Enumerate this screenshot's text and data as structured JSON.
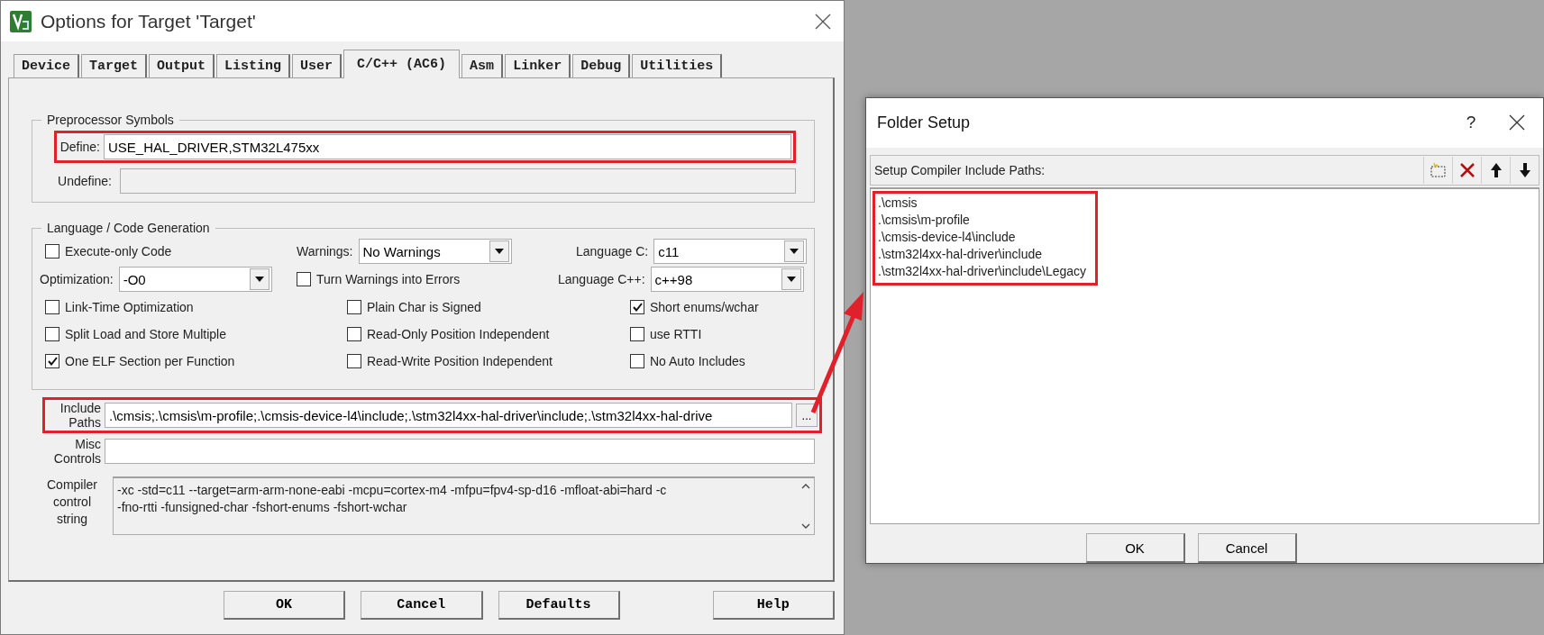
{
  "options_dialog": {
    "title": "Options for Target 'Target'",
    "tabs": [
      {
        "label": "Device",
        "selected": false
      },
      {
        "label": "Target",
        "selected": false
      },
      {
        "label": "Output",
        "selected": false
      },
      {
        "label": "Listing",
        "selected": false
      },
      {
        "label": "User",
        "selected": false
      },
      {
        "label": "C/C++ (AC6)",
        "selected": true
      },
      {
        "label": "Asm",
        "selected": false
      },
      {
        "label": "Linker",
        "selected": false
      },
      {
        "label": "Debug",
        "selected": false
      },
      {
        "label": "Utilities",
        "selected": false
      }
    ],
    "preprocessor": {
      "title": "Preprocessor Symbols",
      "define": {
        "label": "Define:",
        "value": "USE_HAL_DRIVER,STM32L475xx",
        "highlighted": true
      },
      "undefine": {
        "label": "Undefine:",
        "disabled": true
      }
    },
    "code_generation": {
      "title": "Language / Code Generation",
      "rows": [
        [
          {
            "kind": "checkbox",
            "label": "Execute-only Code",
            "checked": false
          },
          {
            "kind": "dropdown",
            "label": "Warnings:",
            "value": "No Warnings"
          },
          {
            "kind": "dropdown",
            "label": "Language C:",
            "value": "c11"
          }
        ],
        [
          {
            "kind": "dropdown",
            "label": "Optimization:",
            "value": "-O0"
          },
          {
            "kind": "checkbox",
            "label": "Turn Warnings into Errors",
            "checked": false
          },
          {
            "kind": "dropdown",
            "label": "Language C++:",
            "value": "c++98"
          }
        ],
        [
          {
            "kind": "checkbox",
            "label": "Link-Time Optimization",
            "checked": false
          },
          {
            "kind": "checkbox",
            "label": "Plain Char is Signed",
            "checked": false
          },
          {
            "kind": "checkbox",
            "label": "Short enums/wchar",
            "checked": true
          }
        ],
        [
          {
            "kind": "checkbox",
            "label": "Split Load and Store Multiple",
            "checked": false
          },
          {
            "kind": "checkbox",
            "label": "Read-Only Position Independent",
            "checked": false
          },
          {
            "kind": "checkbox",
            "label": "use RTTI",
            "checked": false
          }
        ],
        [
          {
            "kind": "checkbox",
            "label": "One ELF Section per Function",
            "checked": true
          },
          {
            "kind": "checkbox",
            "label": "Read-Write Position Independent",
            "checked": false
          },
          {
            "kind": "checkbox",
            "label": "No Auto Includes",
            "checked": false
          }
        ]
      ]
    },
    "include_paths": {
      "label": "Include Paths",
      "value": ".\\cmsis;.\\cmsis\\m-profile;.\\cmsis-device-l4\\include;.\\stm32l4xx-hal-driver\\include;.\\stm32l4xx-hal-drive",
      "browse": "...",
      "highlighted": true
    },
    "misc_controls": {
      "label": "Misc Controls"
    },
    "compiler_string": {
      "label": "Compiler control string",
      "lines": [
        "-xc -std=c11 --target=arm-arm-none-eabi -mcpu=cortex-m4 -mfpu=fpv4-sp-d16 -mfloat-abi=hard -c",
        "-fno-rtti -funsigned-char -fshort-enums -fshort-wchar"
      ]
    },
    "buttons": [
      "OK",
      "Cancel",
      "Defaults",
      "Help"
    ]
  },
  "folder_setup": {
    "title": "Folder Setup",
    "help": "?",
    "list_label": "Setup Compiler Include Paths:",
    "paths": [
      ".\\cmsis",
      ".\\cmsis\\m-profile",
      ".\\cmsis-device-l4\\include",
      ".\\stm32l4xx-hal-driver\\include",
      ".\\stm32l4xx-hal-driver\\include\\Legacy"
    ],
    "highlighted": true,
    "buttons": [
      "OK",
      "Cancel"
    ]
  }
}
